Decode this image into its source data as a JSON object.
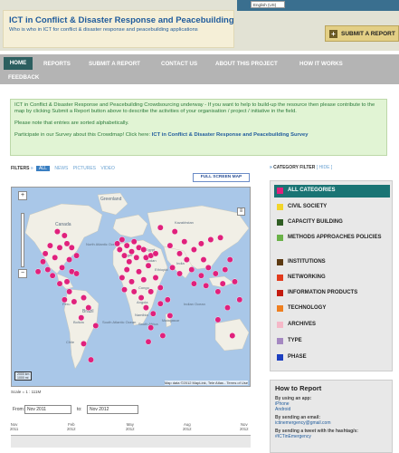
{
  "header": {
    "title": "ICT in Conflict & Disaster Response and Peacebuilding",
    "subtitle": "Who is who in ICT for conflict & disaster response and peacebuilding applications",
    "language": "English (US)",
    "submit_label": "SUBMIT A REPORT",
    "submit_icon": "plus-icon"
  },
  "nav": {
    "items": [
      "HOME",
      "REPORTS",
      "SUBMIT A REPORT",
      "CONTACT US",
      "ABOUT THIS PROJECT",
      "HOW IT WORKS",
      "FEEDBACK"
    ]
  },
  "info": {
    "p1": "ICT in Conflict & Disaster Response and Peacebuilding Crowdsourcing underway - If you want to help to build-up the resource then please contribute to the map by clicking Submit a Report button above to describe the activities of your organisation / project / initiative in the field.",
    "p2": "Please note that entries are sorted alphabetically.",
    "p3_prefix": "Participate in our Survey about this Crowdmap! Click here: ",
    "p3_link": "ICT in Conflict & Disaster Response and Peacebuilding Survey"
  },
  "filters": {
    "label": "FILTERS",
    "arrow": "»",
    "options": [
      "ALL",
      "NEWS",
      "PICTURES",
      "VIDEO"
    ]
  },
  "map": {
    "fullscreen_label": "FULL SCREEN MAP",
    "credit": "Map data ©2012 MapLink, Tele Atlas - Terms of Use",
    "scale_km": "2000 km",
    "scale_mi": "1000 mi",
    "scale_text": "Scale = 1 : 111M",
    "labels": [
      "Greenland",
      "Canada",
      "North Atlantic Ocean",
      "Brazil",
      "Bolivia",
      "Peru",
      "Chile",
      "South Atlantic Ocean",
      "Angola",
      "Namibia",
      "South Africa",
      "Congo",
      "Kazakhstan",
      "India",
      "Indian Ocean",
      "Madagascar",
      "Egypt",
      "Sudan",
      "Ethiopia",
      "Niger"
    ],
    "marker_color": "#e0217c",
    "markers": [
      [
        0.19,
        0.22
      ],
      [
        0.22,
        0.24
      ],
      [
        0.23,
        0.28
      ],
      [
        0.25,
        0.3
      ],
      [
        0.2,
        0.3
      ],
      [
        0.18,
        0.35
      ],
      [
        0.24,
        0.36
      ],
      [
        0.27,
        0.34
      ],
      [
        0.14,
        0.33
      ],
      [
        0.16,
        0.29
      ],
      [
        0.13,
        0.37
      ],
      [
        0.21,
        0.4
      ],
      [
        0.25,
        0.42
      ],
      [
        0.17,
        0.44
      ],
      [
        0.2,
        0.48
      ],
      [
        0.23,
        0.47
      ],
      [
        0.15,
        0.41
      ],
      [
        0.27,
        0.43
      ],
      [
        0.11,
        0.42
      ],
      [
        0.24,
        0.52
      ],
      [
        0.26,
        0.57
      ],
      [
        0.32,
        0.6
      ],
      [
        0.29,
        0.65
      ],
      [
        0.35,
        0.69
      ],
      [
        0.3,
        0.78
      ],
      [
        0.33,
        0.86
      ],
      [
        0.3,
        0.55
      ],
      [
        0.22,
        0.56
      ],
      [
        0.46,
        0.26
      ],
      [
        0.48,
        0.29
      ],
      [
        0.51,
        0.27
      ],
      [
        0.5,
        0.32
      ],
      [
        0.53,
        0.3
      ],
      [
        0.55,
        0.31
      ],
      [
        0.47,
        0.34
      ],
      [
        0.52,
        0.35
      ],
      [
        0.56,
        0.35
      ],
      [
        0.49,
        0.37
      ],
      [
        0.45,
        0.31
      ],
      [
        0.44,
        0.28
      ],
      [
        0.58,
        0.34
      ],
      [
        0.6,
        0.33
      ],
      [
        0.57,
        0.39
      ],
      [
        0.53,
        0.42
      ],
      [
        0.48,
        0.41
      ],
      [
        0.46,
        0.45
      ],
      [
        0.5,
        0.47
      ],
      [
        0.55,
        0.46
      ],
      [
        0.6,
        0.45
      ],
      [
        0.62,
        0.5
      ],
      [
        0.58,
        0.52
      ],
      [
        0.54,
        0.55
      ],
      [
        0.51,
        0.52
      ],
      [
        0.47,
        0.51
      ],
      [
        0.56,
        0.6
      ],
      [
        0.59,
        0.63
      ],
      [
        0.62,
        0.58
      ],
      [
        0.65,
        0.56
      ],
      [
        0.58,
        0.7
      ],
      [
        0.63,
        0.74
      ],
      [
        0.57,
        0.77
      ],
      [
        0.66,
        0.64
      ],
      [
        0.62,
        0.2
      ],
      [
        0.68,
        0.22
      ],
      [
        0.72,
        0.27
      ],
      [
        0.66,
        0.29
      ],
      [
        0.7,
        0.33
      ],
      [
        0.73,
        0.36
      ],
      [
        0.76,
        0.31
      ],
      [
        0.79,
        0.28
      ],
      [
        0.83,
        0.26
      ],
      [
        0.87,
        0.25
      ],
      [
        0.8,
        0.36
      ],
      [
        0.75,
        0.41
      ],
      [
        0.79,
        0.44
      ],
      [
        0.82,
        0.4
      ],
      [
        0.85,
        0.43
      ],
      [
        0.89,
        0.41
      ],
      [
        0.91,
        0.36
      ],
      [
        0.76,
        0.48
      ],
      [
        0.81,
        0.49
      ],
      [
        0.86,
        0.52
      ],
      [
        0.88,
        0.48
      ],
      [
        0.93,
        0.47
      ],
      [
        0.95,
        0.56
      ],
      [
        0.9,
        0.6
      ],
      [
        0.86,
        0.66
      ],
      [
        0.92,
        0.74
      ],
      [
        0.67,
        0.4
      ],
      [
        0.7,
        0.43
      ]
    ]
  },
  "date_range": {
    "from_label": "From:",
    "from_value": "Nov 2011",
    "to_label": "to:",
    "to_value": "Nov 2012"
  },
  "timeline": {
    "ticks": [
      {
        "m": "Nov",
        "y": "2011"
      },
      {
        "m": "Feb",
        "y": "2012"
      },
      {
        "m": "May",
        "y": "2012"
      },
      {
        "m": "Aug",
        "y": "2012"
      },
      {
        "m": "Nov",
        "y": "2012"
      }
    ]
  },
  "category_filter": {
    "label": "CATEGORY FILTER",
    "hide_label": "[ HIDE ]",
    "arrow": "»",
    "items": [
      {
        "label": "ALL CATEGORIES",
        "color": "#e0217c"
      },
      {
        "label": "CIVIL SOCIETY",
        "color": "#f2d52a"
      },
      {
        "label": "CAPACITY BUILDING",
        "color": "#2f5d23"
      },
      {
        "label": "METHODS APPROACHES POLICIES",
        "color": "#6ab248"
      },
      {
        "label": "INSTITUTIONS",
        "color": "#5c3a12"
      },
      {
        "label": "NETWORKING",
        "color": "#e23b1d"
      },
      {
        "label": "INFORMATION PRODUCTS",
        "color": "#c41a0e"
      },
      {
        "label": "TECHNOLOGY",
        "color": "#ef7f1f"
      },
      {
        "label": "ARCHIVES",
        "color": "#f5b8c8"
      },
      {
        "label": "TYPE",
        "color": "#a488c1"
      },
      {
        "label": "PHASE",
        "color": "#1c3fc0"
      }
    ]
  },
  "how_to_report": {
    "title": "How to Report",
    "app_title": "By using an app:",
    "apps": [
      "iPhone",
      "Android"
    ],
    "email_title": "By sending an email:",
    "email": "ictinemergency@gmail.com",
    "tweet_title": "By sending a tweet with the hashtag/s:",
    "hashtag": "#ICTinEmergency"
  }
}
